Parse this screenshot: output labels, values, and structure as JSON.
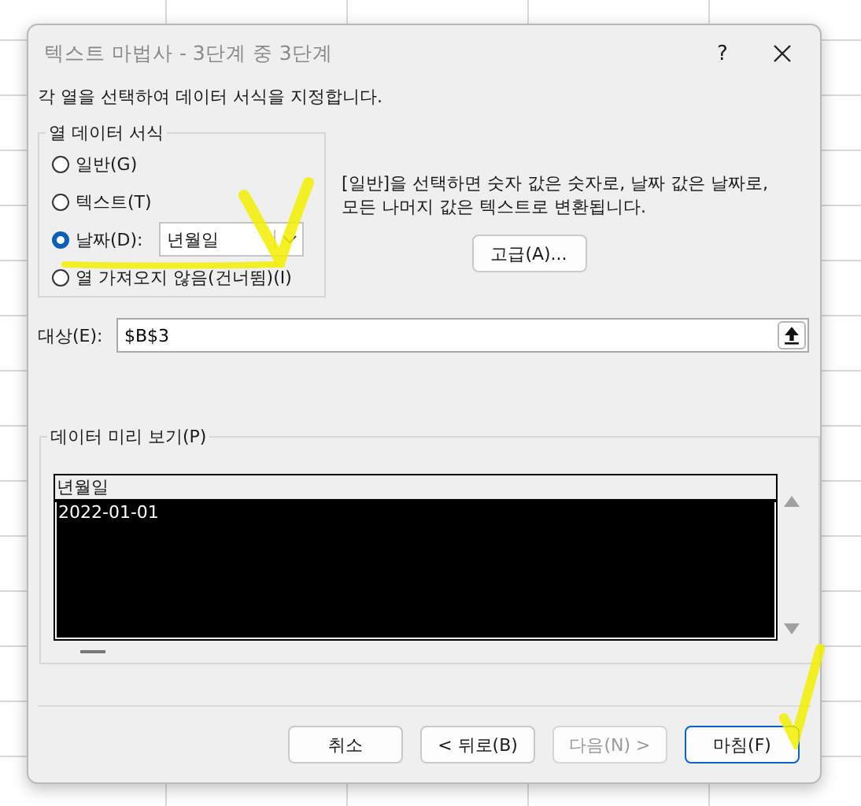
{
  "window": {
    "title": "텍스트 마법사 - 3단계 중 3단계",
    "help": "?"
  },
  "instruction": "각 열을 선택하여 데이터 서식을 지정합니다.",
  "column_format": {
    "legend": "열 데이터 서식",
    "date_format": "년월일",
    "options": [
      {
        "label": "일반(G)",
        "selected": false,
        "kind": "plain"
      },
      {
        "label": "텍스트(T)",
        "selected": false,
        "kind": "plain"
      },
      {
        "label": "날짜(D):",
        "selected": true,
        "kind": "date"
      },
      {
        "label": "열 가져오지 않음(건너뜀)(I)",
        "selected": false,
        "kind": "plain"
      }
    ]
  },
  "description": "[일반]을 선택하면 숫자 값은 숫자로, 날짜 값은 날짜로,\n모든 나머지 값은 텍스트로 변환됩니다.",
  "advanced_button": "고급(A)...",
  "destination": {
    "label": "대상(E):",
    "value": "$B$3"
  },
  "preview": {
    "legend": "데이터 미리 보기(P)",
    "header": "년월일",
    "rows": [
      "2022-01-01"
    ]
  },
  "buttons": [
    {
      "label": "취소",
      "disabled": false,
      "default": false
    },
    {
      "label": "< 뒤로(B)",
      "disabled": false,
      "default": false
    },
    {
      "label": "다음(N) >",
      "disabled": true,
      "default": false
    },
    {
      "label": "마침(F)",
      "disabled": false,
      "default": true
    }
  ]
}
